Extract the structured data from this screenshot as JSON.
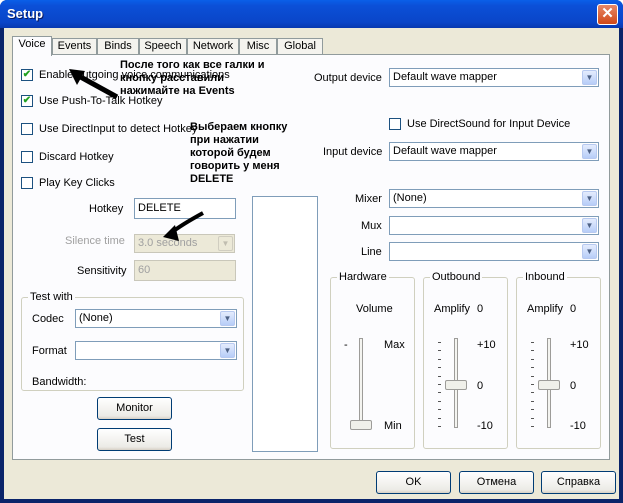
{
  "window": {
    "title": "Setup",
    "close_glyph": "✕"
  },
  "tabs": [
    {
      "label": "Voice",
      "active": true
    },
    {
      "label": "Events"
    },
    {
      "label": "Binds"
    },
    {
      "label": "Speech"
    },
    {
      "label": "Network"
    },
    {
      "label": "Misc"
    },
    {
      "label": "Global"
    }
  ],
  "left": {
    "checkboxes": [
      {
        "label": "Enable outgoing voice communications",
        "checked": true
      },
      {
        "label": "Use Push-To-Talk Hotkey",
        "checked": true
      },
      {
        "label": "Use DirectInput to detect Hotkey",
        "checked": false
      },
      {
        "label": "Discard Hotkey",
        "checked": false
      },
      {
        "label": "Play Key Clicks",
        "checked": false
      }
    ],
    "hotkey_label": "Hotkey",
    "hotkey_value": "DELETE",
    "silence_label": "Silence time",
    "silence_value": "3.0 seconds",
    "sensitivity_label": "Sensitivity",
    "sensitivity_value": "60"
  },
  "testwith": {
    "title": "Test with",
    "codec_label": "Codec",
    "codec_value": "(None)",
    "format_label": "Format",
    "format_value": "",
    "bandwidth_label": "Bandwidth:"
  },
  "buttons": {
    "monitor": "Monitor",
    "test": "Test",
    "ok": "OK",
    "cancel": "Отмена",
    "help": "Справка"
  },
  "right": {
    "output_device_label": "Output device",
    "output_device_value": "Default wave mapper",
    "directsound_label": "Use DirectSound for Input Device",
    "input_device_label": "Input device",
    "input_device_value": "Default wave mapper",
    "mixer_label": "Mixer",
    "mixer_value": "(None)",
    "mux_label": "Mux",
    "mux_value": "",
    "line_label": "Line",
    "line_value": ""
  },
  "hardware": {
    "title": "Hardware",
    "volume": "Volume",
    "max": "Max",
    "min": "Min",
    "minus": "-"
  },
  "outbound": {
    "title": "Outbound",
    "amplify": "Amplify",
    "amp_value": "0",
    "plus10": "+10",
    "zero": "0",
    "minus10": "-10"
  },
  "inbound": {
    "title": "Inbound",
    "amplify": "Amplify",
    "amp_value": "0",
    "plus10": "+10",
    "zero": "0",
    "minus10": "-10"
  },
  "annotations": {
    "note1": [
      "После того как все галки и",
      "кнопку расставили",
      "нажимайте на Events"
    ],
    "note2": [
      "Выбераем кнопку",
      "при нажатии",
      "которой будем",
      "говорить у меня",
      "DELETE"
    ]
  }
}
